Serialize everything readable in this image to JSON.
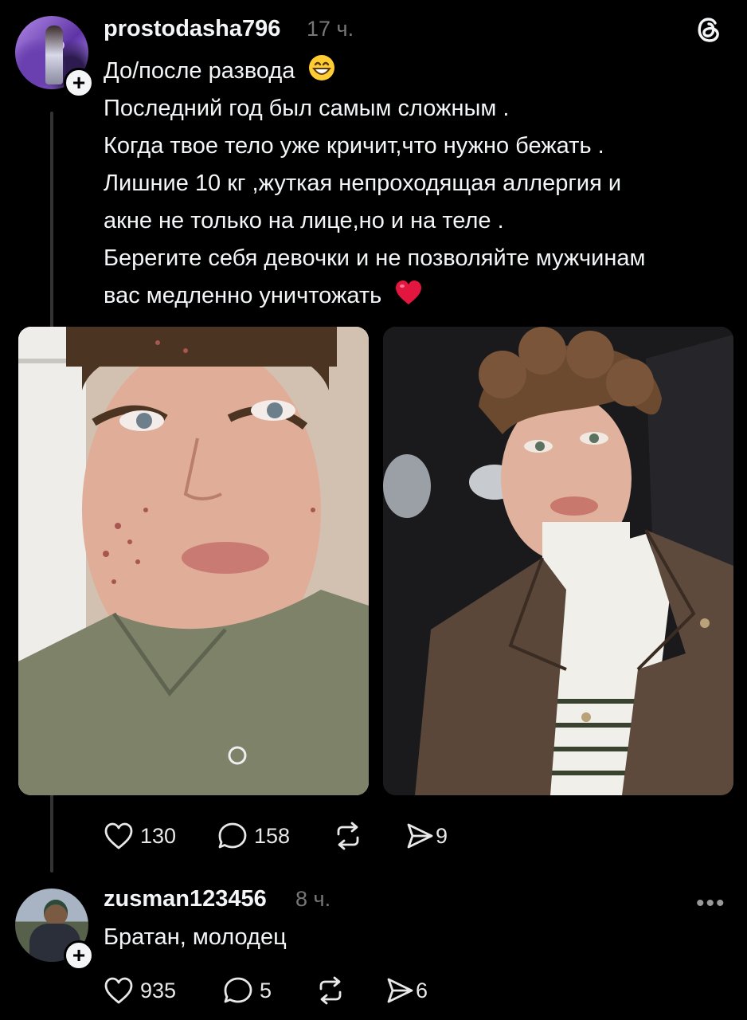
{
  "post": {
    "username": "prostodasha796",
    "time": "17 ч.",
    "lines": [
      "До/после развода",
      "Последний год был самым сложным .",
      "Когда твое тело уже кричит,что нужно бежать .",
      "Лишние 10 кг ,жуткая непроходящая аллергия и",
      "акне не только на лице,но и на теле .",
      "Берегите себя девочки и не позволяйте мужчинам",
      "вас медленно уничтожать"
    ],
    "emoji_first_line": "grinning-face",
    "emoji_last_line": "red-heart",
    "likes": "130",
    "comments": "158",
    "shares": "9"
  },
  "reply": {
    "username": "zusman123456",
    "time": "8 ч.",
    "text": "Братан, молодец",
    "likes": "935",
    "comments": "5",
    "shares": "6"
  },
  "icons": {
    "app_logo": "threads-logo-icon",
    "like": "heart-icon",
    "comment": "comment-bubble-icon",
    "repost": "repost-icon",
    "share": "send-icon",
    "more": "more-dots-icon",
    "follow": "plus-icon"
  },
  "colors": {
    "background": "#000000",
    "text": "#f3f5f7",
    "muted": "#777777",
    "heart": "#e3163f"
  }
}
